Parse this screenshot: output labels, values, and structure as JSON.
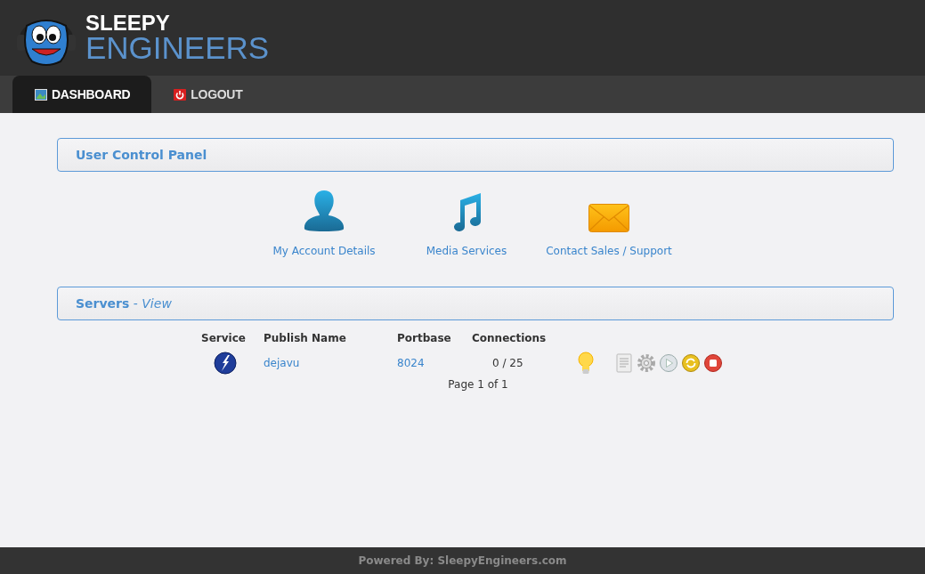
{
  "logo": {
    "line_1": "SLEEPY",
    "line_2": "ENGINEERS"
  },
  "nav": [
    {
      "label": "DASHBOARD",
      "selected": true
    },
    {
      "label": "LOGOUT",
      "selected": false
    }
  ],
  "control_panel": {
    "title": "User Control Panel",
    "shortcuts": [
      {
        "label": "My Account Details"
      },
      {
        "label": "Media Services"
      },
      {
        "label": "Contact Sales / Support"
      }
    ]
  },
  "servers": {
    "title": "**Servers** - *View*",
    "columns": [
      "Service",
      "Publish Name",
      "Portbase",
      "Connections"
    ],
    "rows": [
      {
        "publish_name": "dejavu",
        "portbase": "8024",
        "connections": "0 / 25",
        "on": true
      }
    ],
    "pagination": "Page 1 of 1"
  },
  "footer": "Powered By: SleepyEngineers.com"
}
